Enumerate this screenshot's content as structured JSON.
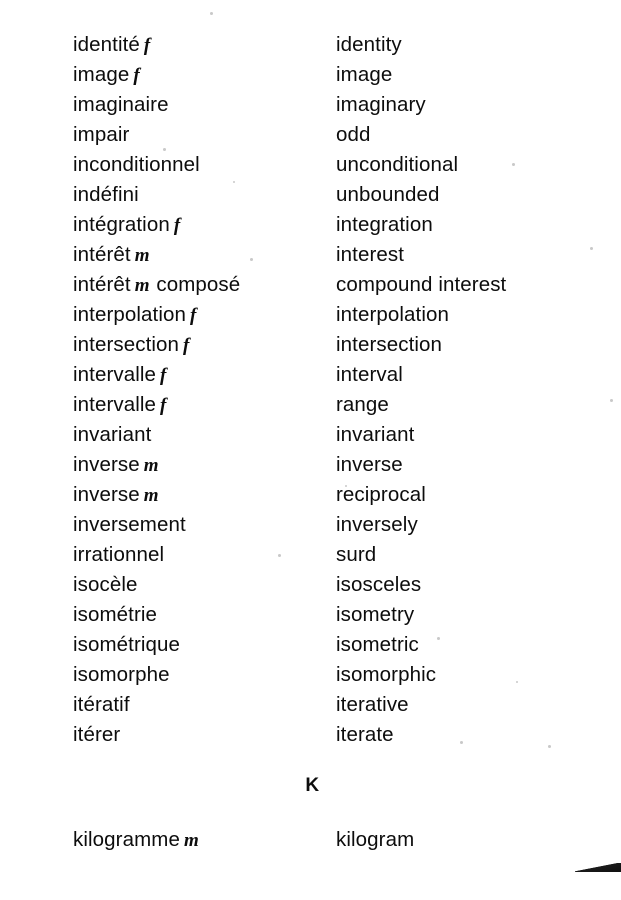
{
  "page": {
    "background_color": "#ffffff",
    "text_color": "#0d0d0d"
  },
  "columns": {
    "source_language": "French",
    "target_language": "English"
  },
  "entries": [
    {
      "fr": "identité",
      "gender": "f",
      "fr_suffix": "",
      "en": "identity"
    },
    {
      "fr": "image",
      "gender": "f",
      "fr_suffix": "",
      "en": "image"
    },
    {
      "fr": "imaginaire",
      "gender": "",
      "fr_suffix": "",
      "en": "imaginary"
    },
    {
      "fr": "impair",
      "gender": "",
      "fr_suffix": "",
      "en": "odd"
    },
    {
      "fr": "inconditionnel",
      "gender": "",
      "fr_suffix": "",
      "en": "unconditional"
    },
    {
      "fr": "indéfini",
      "gender": "",
      "fr_suffix": "",
      "en": "unbounded"
    },
    {
      "fr": "intégration",
      "gender": "f",
      "fr_suffix": "",
      "en": "integration"
    },
    {
      "fr": "intérêt",
      "gender": "m",
      "fr_suffix": "",
      "en": "interest"
    },
    {
      "fr": "intérêt",
      "gender": "m",
      "fr_suffix": "composé",
      "en": "compound interest"
    },
    {
      "fr": "interpolation",
      "gender": "f",
      "fr_suffix": "",
      "en": "interpolation"
    },
    {
      "fr": "intersection",
      "gender": "f",
      "fr_suffix": "",
      "en": "intersection"
    },
    {
      "fr": "intervalle",
      "gender": "f",
      "fr_suffix": "",
      "en": "interval"
    },
    {
      "fr": "intervalle",
      "gender": "f",
      "fr_suffix": "",
      "en": "range"
    },
    {
      "fr": "invariant",
      "gender": "",
      "fr_suffix": "",
      "en": "invariant"
    },
    {
      "fr": "inverse",
      "gender": "m",
      "fr_suffix": "",
      "en": "inverse"
    },
    {
      "fr": "inverse",
      "gender": "m",
      "fr_suffix": "",
      "en": "reciprocal"
    },
    {
      "fr": "inversement",
      "gender": "",
      "fr_suffix": "",
      "en": "inversely"
    },
    {
      "fr": "irrationnel",
      "gender": "",
      "fr_suffix": "",
      "en": "surd"
    },
    {
      "fr": "isocèle",
      "gender": "",
      "fr_suffix": "",
      "en": "isosceles"
    },
    {
      "fr": "isométrie",
      "gender": "",
      "fr_suffix": "",
      "en": "isometry"
    },
    {
      "fr": "isométrique",
      "gender": "",
      "fr_suffix": "",
      "en": "isometric"
    },
    {
      "fr": "isomorphe",
      "gender": "",
      "fr_suffix": "",
      "en": "isomorphic"
    },
    {
      "fr": "itératif",
      "gender": "",
      "fr_suffix": "",
      "en": "iterative"
    },
    {
      "fr": "itérer",
      "gender": "",
      "fr_suffix": "",
      "en": "iterate"
    }
  ],
  "section_heading": {
    "letter": "K"
  },
  "k_entries": [
    {
      "fr": "kilogramme",
      "gender": "m",
      "fr_suffix": "",
      "en": "kilogram"
    }
  ]
}
